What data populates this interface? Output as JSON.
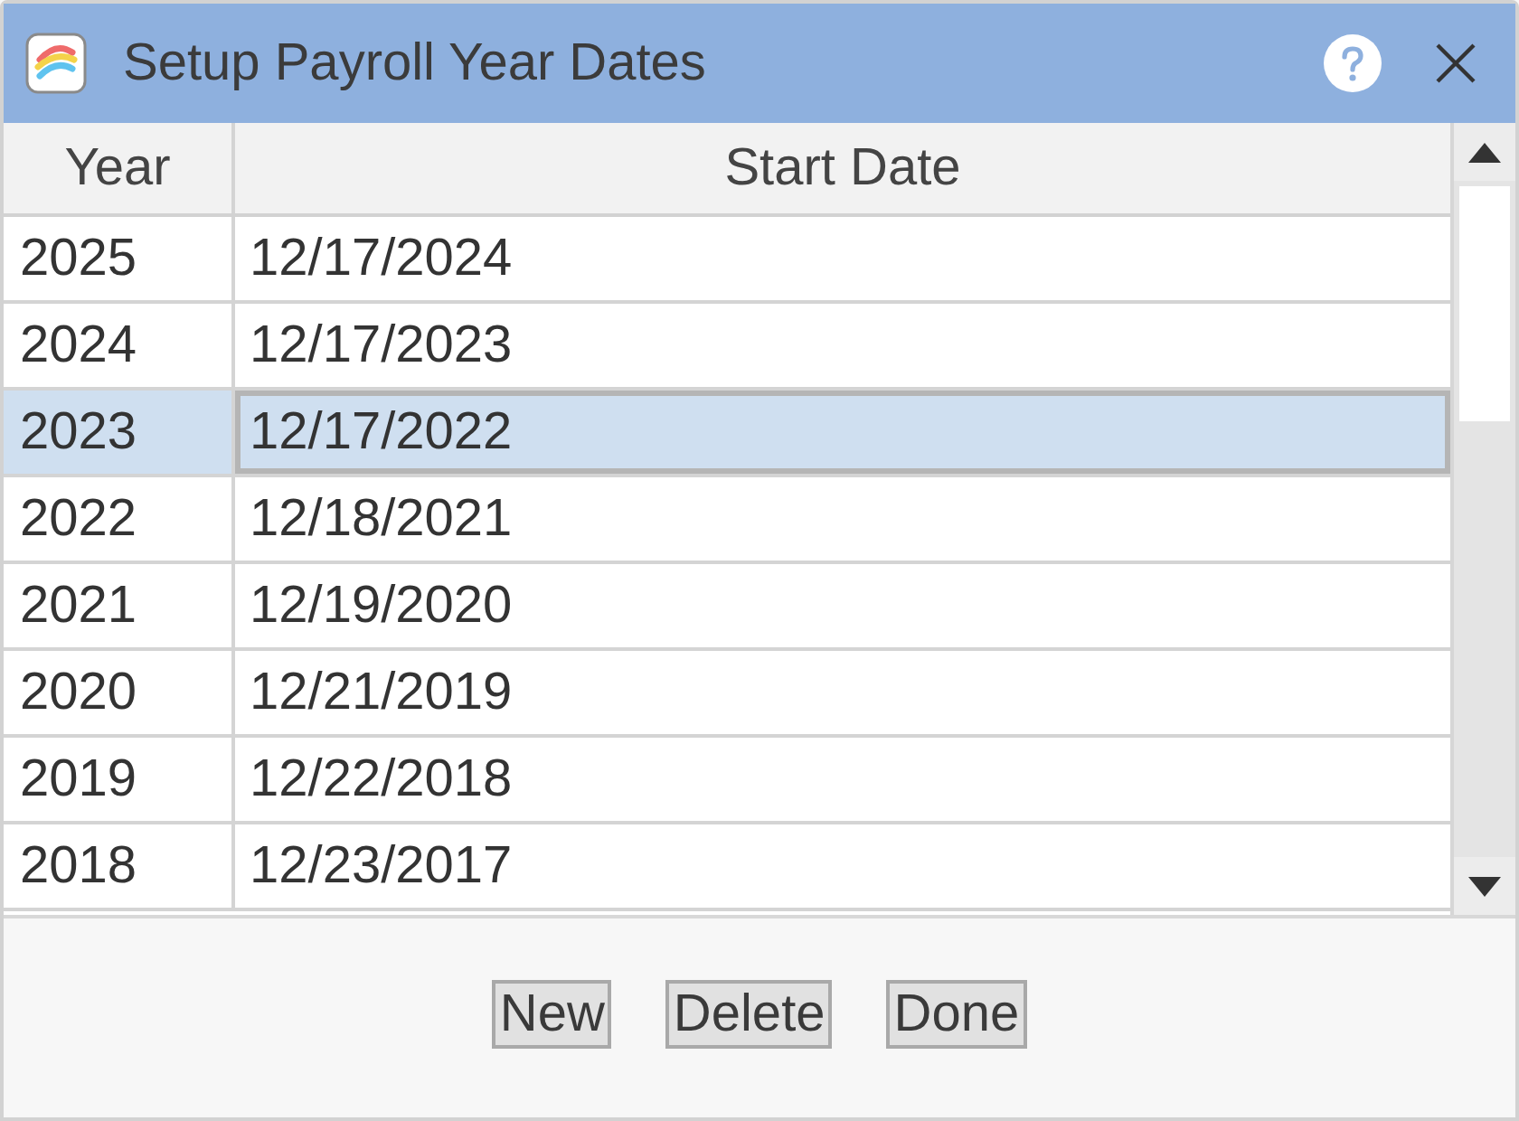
{
  "window": {
    "title": "Setup Payroll Year Dates"
  },
  "table": {
    "columns": [
      "Year",
      "Start Date"
    ],
    "rows": [
      {
        "year": "2025",
        "start_date": "12/17/2024",
        "selected": false
      },
      {
        "year": "2024",
        "start_date": "12/17/2023",
        "selected": false
      },
      {
        "year": "2023",
        "start_date": "12/17/2022",
        "selected": true
      },
      {
        "year": "2022",
        "start_date": "12/18/2021",
        "selected": false
      },
      {
        "year": "2021",
        "start_date": "12/19/2020",
        "selected": false
      },
      {
        "year": "2020",
        "start_date": "12/21/2019",
        "selected": false
      },
      {
        "year": "2019",
        "start_date": "12/22/2018",
        "selected": false
      },
      {
        "year": "2018",
        "start_date": "12/23/2017",
        "selected": false
      }
    ]
  },
  "buttons": [
    "New",
    "Delete",
    "Done"
  ]
}
